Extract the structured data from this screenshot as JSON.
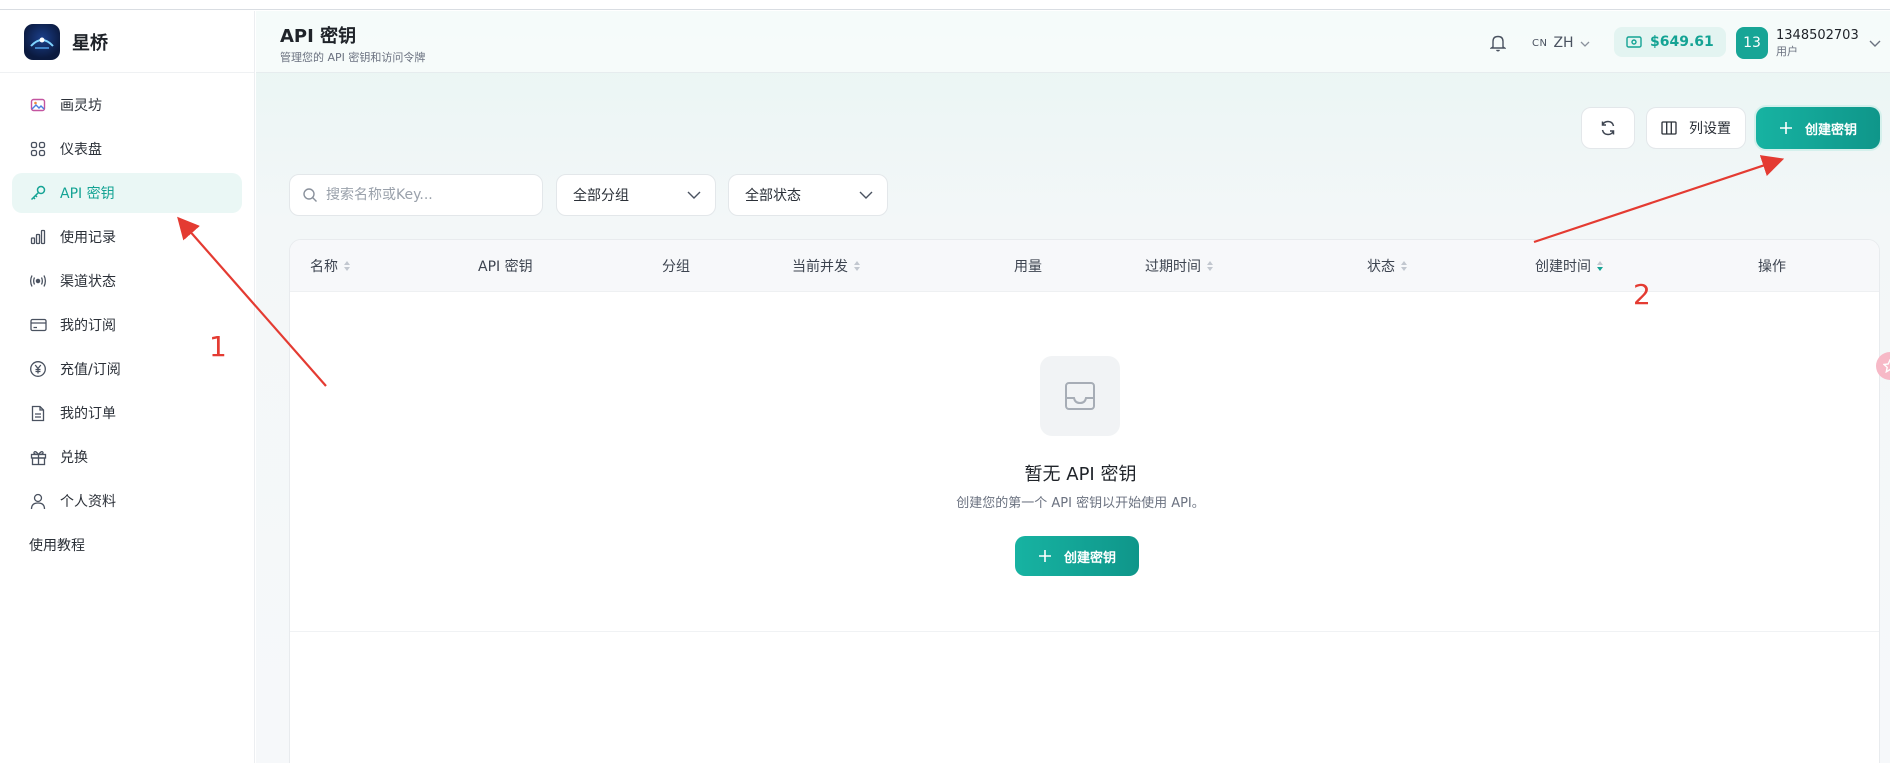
{
  "brand": {
    "name": "星桥"
  },
  "sidebar": {
    "items": [
      {
        "label": "画灵坊"
      },
      {
        "label": "仪表盘"
      },
      {
        "label": "API 密钥"
      },
      {
        "label": "使用记录"
      },
      {
        "label": "渠道状态"
      },
      {
        "label": "我的订阅"
      },
      {
        "label": "充值/订阅"
      },
      {
        "label": "我的订单"
      },
      {
        "label": "兑换"
      },
      {
        "label": "个人资料"
      },
      {
        "label": "使用教程"
      }
    ]
  },
  "header": {
    "title": "API 密钥",
    "subtitle": "管理您的 API 密钥和访问令牌",
    "lang_prefix": "CN",
    "lang": "ZH",
    "balance": "$649.61",
    "avatar_text": "13",
    "user_name": "1348502703",
    "user_role": "用户"
  },
  "toolbar": {
    "columns_label": "列设置",
    "create_label": "创建密钥"
  },
  "filters": {
    "search_placeholder": "搜索名称或Key...",
    "group_value": "全部分组",
    "status_value": "全部状态"
  },
  "table": {
    "columns": [
      "名称",
      "API 密钥",
      "分组",
      "当前并发",
      "用量",
      "过期时间",
      "状态",
      "创建时间",
      "操作"
    ]
  },
  "empty": {
    "title": "暂无 API 密钥",
    "description": "创建您的第一个 API 密钥以开始使用 API。",
    "button_label": "创建密钥"
  },
  "annotations": {
    "label_1": "1",
    "label_2": "2",
    "color": "#e43b32"
  },
  "colors": {
    "accent": "#14a394",
    "accent_bg": "#eaf7f5"
  }
}
